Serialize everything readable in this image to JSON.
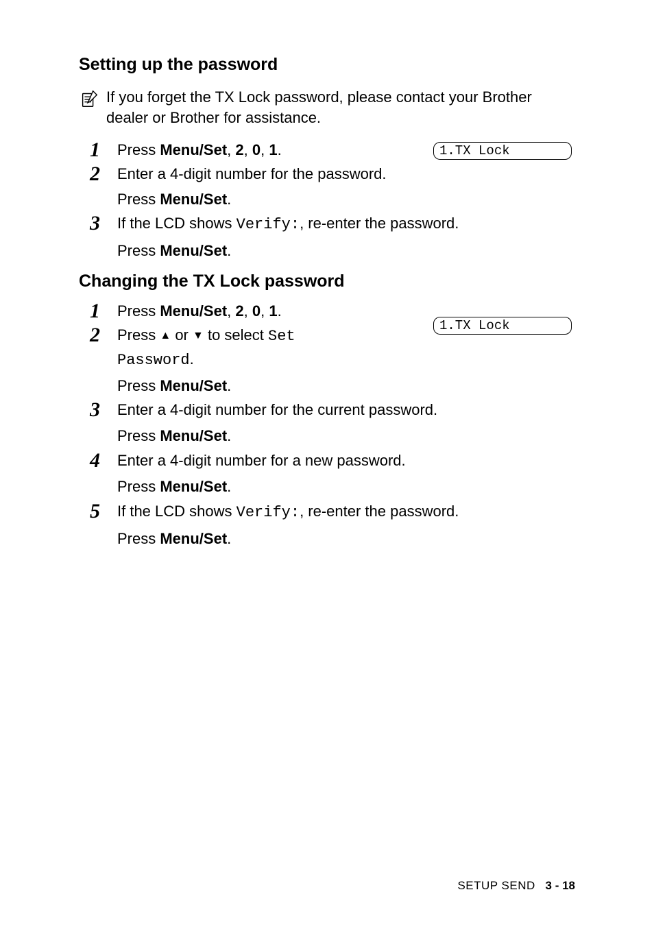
{
  "heading1": "Setting up the password",
  "note": "If you forget the TX Lock password, please contact your Brother dealer or Brother for assistance.",
  "lcd_display": "1.TX Lock",
  "section1": {
    "step1": {
      "num": "1",
      "pre": "Press ",
      "bold": "Menu/Set",
      "post": ", ",
      "b2": "2",
      "comma2": ", ",
      "b0": "0",
      "comma3": ", ",
      "b1": "1",
      "period": "."
    },
    "step2": {
      "num": "2",
      "line1": "Enter a 4-digit number for the password.",
      "line2pre": "Press ",
      "line2bold": "Menu/Set",
      "line2post": "."
    },
    "step3": {
      "num": "3",
      "pre": "If the LCD shows ",
      "mono": "Verify:",
      "post": ", re-enter the password.",
      "line2pre": "Press ",
      "line2bold": "Menu/Set",
      "line2post": "."
    }
  },
  "heading2": "Changing the TX Lock password",
  "section2": {
    "step1": {
      "num": "1",
      "pre": "Press ",
      "bold": "Menu/Set",
      "post": ", ",
      "b2": "2",
      "comma2": ", ",
      "b0": "0",
      "comma3": ", ",
      "b1": "1",
      "period": "."
    },
    "step2": {
      "num": "2",
      "pre": "Press ",
      "mid": " or ",
      "post": " to select ",
      "mono1": "Set",
      "mono2": "Password",
      "period": ".",
      "line2pre": "Press ",
      "line2bold": "Menu/Set",
      "line2post": "."
    },
    "step3": {
      "num": "3",
      "line1": "Enter a 4-digit number for the current password.",
      "line2pre": "Press ",
      "line2bold": "Menu/Set",
      "line2post": "."
    },
    "step4": {
      "num": "4",
      "line1": "Enter a 4-digit number for a new password.",
      "line2pre": "Press ",
      "line2bold": "Menu/Set",
      "line2post": "."
    },
    "step5": {
      "num": "5",
      "pre": "If the LCD shows ",
      "mono": "Verify:",
      "post": ", re-enter the password.",
      "line2pre": "Press ",
      "line2bold": "Menu/Set",
      "line2post": "."
    }
  },
  "footer": {
    "section": "SETUP SEND",
    "page": "3 - 18"
  }
}
